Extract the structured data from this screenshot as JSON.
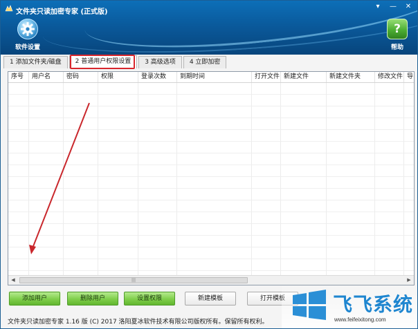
{
  "window": {
    "title": "文件夹只读加密专家 (正式版)",
    "controls": [
      "▾",
      "—",
      "✕"
    ]
  },
  "toolbar": {
    "settings_label": "软件设置",
    "help_label": "帮助",
    "help_glyph": "?"
  },
  "tabs": [
    {
      "label": "1 添加文件夹/磁盘",
      "active": false
    },
    {
      "label": "2 普通用户权限设置",
      "active": true
    },
    {
      "label": "3 高级选项",
      "active": false
    },
    {
      "label": "4 立即加密",
      "active": false
    }
  ],
  "grid": {
    "columns": [
      "序号",
      "用户名",
      "密码",
      "权限",
      "登录次数",
      "到期时间",
      "打开文件",
      "新建文件",
      "新建文件夹",
      "修改文件",
      "导"
    ],
    "rows": []
  },
  "buttons": {
    "add_user": "添加用户",
    "delete_user": "删除用户",
    "set_permission": "设置权限",
    "new_template": "新建模板",
    "open_template": "打开模板"
  },
  "status_text": "文件夹只读加密专家 1.16 版 (C) 2017 洛阳夏冰软件技术有限公司版权所有。保留所有权利。",
  "watermark": {
    "brand": "飞飞系统",
    "url": "www.feifeixitong.com"
  },
  "colors": {
    "header": "#0a5a9c",
    "annotation": "#d8262c",
    "green_button": "#7fce4a"
  }
}
